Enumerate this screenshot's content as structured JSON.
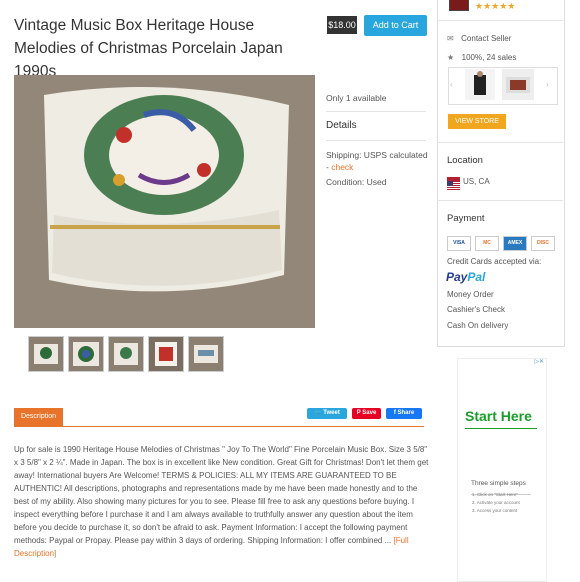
{
  "listing": {
    "title": "Vintage Music Box Heritage House Melodies of Christmas Porcelain Japan 1990s",
    "price": "$18.00",
    "add_to_cart": "Add to Cart",
    "availability": "Only 1 available",
    "details_heading": "Details",
    "shipping_text": "Shipping: USPS calculated -",
    "shipping_link": "check",
    "condition": "Condition: Used"
  },
  "seller": {
    "rating_stars": "★★★★★",
    "contact": "Contact Seller",
    "stats": "100%, 24 sales",
    "view_store": "VIEW STORE"
  },
  "location": {
    "heading": "Location",
    "value": "US, CA"
  },
  "payment": {
    "heading": "Payment",
    "cards": [
      "VISA",
      "MC",
      "AMEX",
      "DISC"
    ],
    "accepted_via": "Credit Cards accepted via:",
    "paypal_a": "Pay",
    "paypal_b": "Pal",
    "methods": [
      "Money Order",
      "Cashier's Check",
      "Cash On delivery"
    ]
  },
  "ad": {
    "headline": "Start Here",
    "steps_title": "Three simple steps",
    "steps": [
      "1. Click on \"Start Here\"",
      "2. Activate your account",
      "3. Access your content"
    ]
  },
  "share": {
    "tweet": "Tweet",
    "save": "Save",
    "fb_share": "Share"
  },
  "description": {
    "tab": "Description",
    "text": "Up for sale is 1990 Heritage House Melodies of Christmas \" Joy To The World\" Fine Porcelain Music Box. Size 3 5/8\" x 3 5/8\" x 2 ¼\". Made in Japan. The box is in excellent like New condition. Great Gift for Christmas! Don't let them get away! International buyers Are Welcome! TERMS & POLICIES: ALL MY ITEMS ARE GUARANTEED TO BE AUTHENTIC! All descriptions, photographs and representations made by me have been made honestly and to the best of my ability. Also showing many pictures for you to see. Please fill free to ask any questions before buying. I inspect everything before I purchase it and I am always available to truthfully answer any question about the item before you decide to purchase it, so don't be afraid to ask. Payment Information: I accept the following payment methods: Paypal or Propay. Please pay within 3 days of ordering. Shipping Information: I offer combined ...",
    "more": "[Full Description]"
  },
  "colors": {
    "accent": "#e8742b",
    "button_blue": "#2aa6de",
    "star": "#f0a61e",
    "ad_green": "#1a9e2a"
  }
}
